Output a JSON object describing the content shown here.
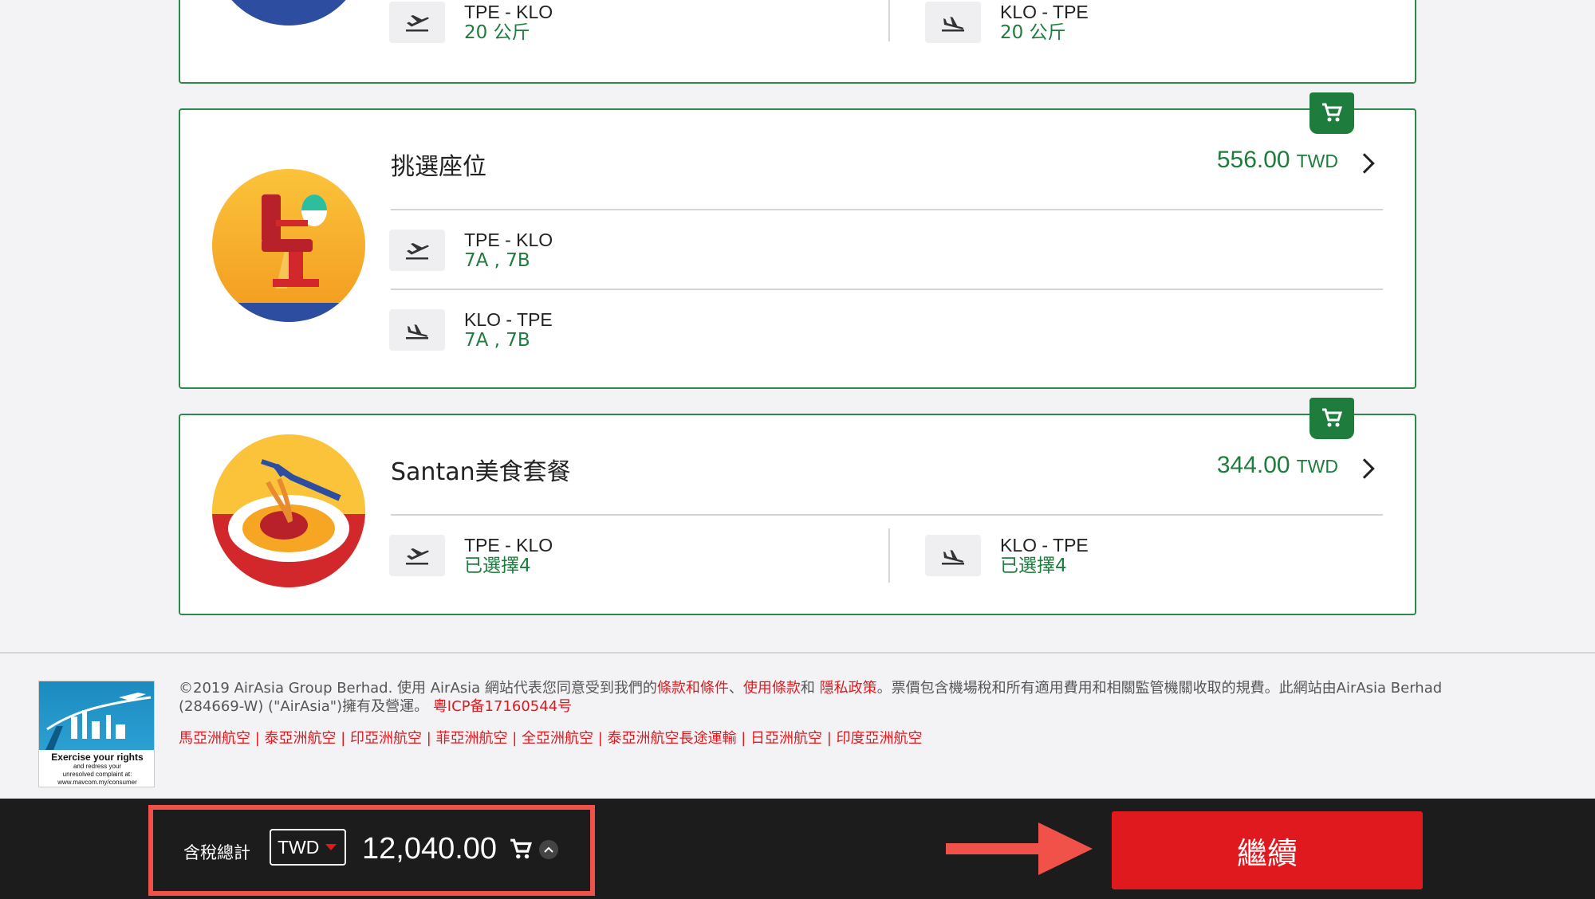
{
  "bags": {
    "legs": [
      {
        "route": "TPE - KLO",
        "detail": "20 公斤"
      },
      {
        "route": "KLO - TPE",
        "detail": "20 公斤"
      }
    ]
  },
  "seats": {
    "title": "挑選座位",
    "price": "556.00",
    "currency": "TWD",
    "legs": [
      {
        "route": "TPE - KLO",
        "detail": "7A , 7B"
      },
      {
        "route": "KLO - TPE",
        "detail": "7A , 7B"
      }
    ]
  },
  "meals": {
    "title": "Santan美食套餐",
    "price": "344.00",
    "currency": "TWD",
    "legs": [
      {
        "route": "TPE - KLO",
        "detail": "已選擇4"
      },
      {
        "route": "KLO - TPE",
        "detail": "已選擇4"
      }
    ]
  },
  "footer": {
    "logo_title": "Exercise your rights",
    "logo_sub1": "and redress your",
    "logo_sub2": "unresolved complaint at:",
    "logo_url": "www.mavcom.my/consumer",
    "copyright_pre": "©2019 AirAsia Group Berhad. 使用 AirAsia 網站代表您同意受到我們的",
    "link_terms": "條款和條件",
    "sep1": "、",
    "link_usage": "使用條款",
    "sep2": "和 ",
    "link_privacy": "隱私政策",
    "copyright_post": "。票價包含機場稅和所有適用費用和相關監管機關收取的規費。此網站由AirAsia Berhad (284669-W) (\"AirAsia\")擁有及營運。 ",
    "icp": "粵ICP备17160544号",
    "airlines_links": "馬亞洲航空 | 泰亞洲航空 | 印亞洲航空 | 菲亞洲航空 | 全亞洲航空 | 泰亞洲航空長途運輸 | 日亞洲航空 | 印度亞洲航空"
  },
  "bottom_bar": {
    "total_label": "含稅總計",
    "currency": "TWD",
    "total": "12,040.00",
    "continue_label": "繼續"
  },
  "colors": {
    "accent_green": "#1e7c3d",
    "brand_red": "#e0191e",
    "highlight": "#f0524a",
    "bar_bg": "#1c1c1c"
  },
  "icons": [
    "luggage-illustration",
    "seat-illustration",
    "meal-illustration",
    "plane-takeoff-icon",
    "plane-landing-icon",
    "cart-icon",
    "chevron-right-icon",
    "chevron-up-icon",
    "caret-down-icon",
    "arrow-right-icon"
  ]
}
